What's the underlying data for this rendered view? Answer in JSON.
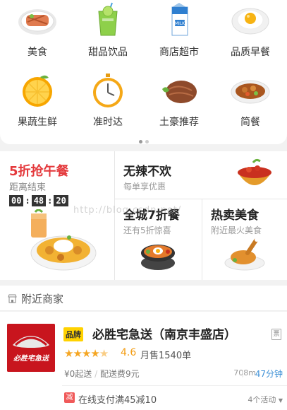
{
  "categories": [
    {
      "label": "美食",
      "icon": "food-plate-icon"
    },
    {
      "label": "甜品饮品",
      "icon": "drink-cup-icon"
    },
    {
      "label": "商店超市",
      "icon": "milk-carton-icon"
    },
    {
      "label": "品质早餐",
      "icon": "fried-egg-icon"
    },
    {
      "label": "果蔬生鲜",
      "icon": "orange-icon"
    },
    {
      "label": "准时达",
      "icon": "stopwatch-icon"
    },
    {
      "label": "土豪推荐",
      "icon": "steak-icon"
    },
    {
      "label": "简餐",
      "icon": "rice-bowl-icon"
    }
  ],
  "pager": {
    "count": 2,
    "active": 0
  },
  "flash_sale": {
    "title": "5折抢午餐",
    "subtitle": "距离结束",
    "hours": "00",
    "minutes": "48",
    "seconds": "20"
  },
  "promos": [
    {
      "title": "无辣不欢",
      "subtitle": "每单享优惠"
    },
    {
      "title": "全城7折餐",
      "subtitle": "还有5折惊喜"
    },
    {
      "title": "热卖美食",
      "subtitle": "附近最火美食"
    }
  ],
  "watermark": "http://blog.csdn.net/",
  "nearby": {
    "title": "附近商家"
  },
  "merchant": {
    "brand_badge": "品牌",
    "name": "必胜宅急送（南京丰盛店）",
    "receipt": "票",
    "rating": "4.6",
    "rating_value": 4.6,
    "monthly_sales": "月售1540单",
    "min_order": "¥0起送",
    "delivery_fee": "配送费9元",
    "distance": "708m",
    "eta": "47分钟",
    "activity_badge": "减",
    "activity_text": "在线支付满45减10",
    "activity_count": "4个活动",
    "logo_text": "必胜宅急送"
  },
  "colors": {
    "accent_red": "#e4393c",
    "brand_yellow": "#ffd200",
    "star": "#f5a623",
    "eta_blue": "#3b8fd6"
  }
}
